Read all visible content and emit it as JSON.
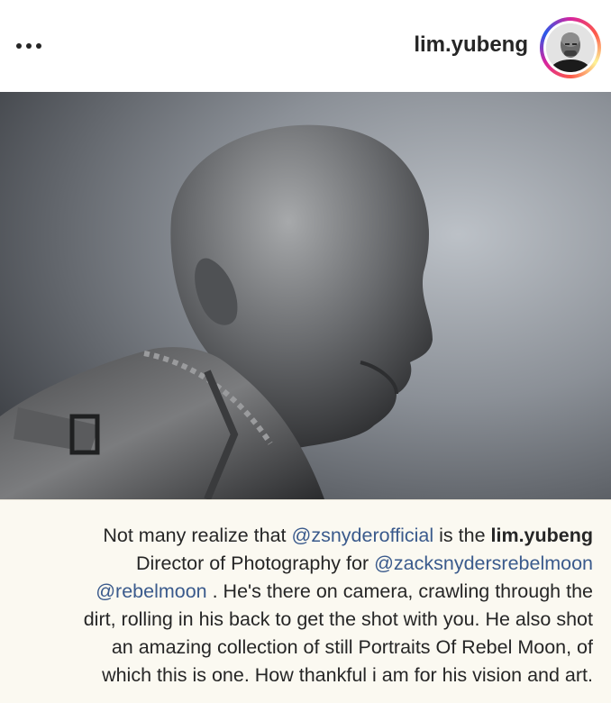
{
  "header": {
    "username": "lim.yubeng",
    "more_icon": "more-horizontal-icon",
    "avatar_alt": "profile avatar"
  },
  "post": {
    "image_subject": "black-and-white portrait of a bald man in profile wearing a worn leather jacket"
  },
  "caption": {
    "line1_prefix": "Not many realize that ",
    "line1_mention": "@zsnyderofficial",
    "line1_mid": " is the ",
    "line1_user": "lim.yubeng",
    "line2_prefix": "Director of Photography for ",
    "line2_mention": "@zacksnydersrebelmoon",
    "line3_mention": "@rebelmoon",
    "line3_text": " . He's there on camera, crawling through the",
    "line4_text": "dirt, rolling in his back to get the shot with you. He also shot",
    "line5_text": "an amazing collection of still Portraits Of Rebel Moon, of",
    "line6_text": "which this is one. How thankful i am for his vision and art."
  },
  "colors": {
    "mention": "#3a5a8c",
    "caption_background": "#fbf9f1",
    "text": "#262626"
  }
}
